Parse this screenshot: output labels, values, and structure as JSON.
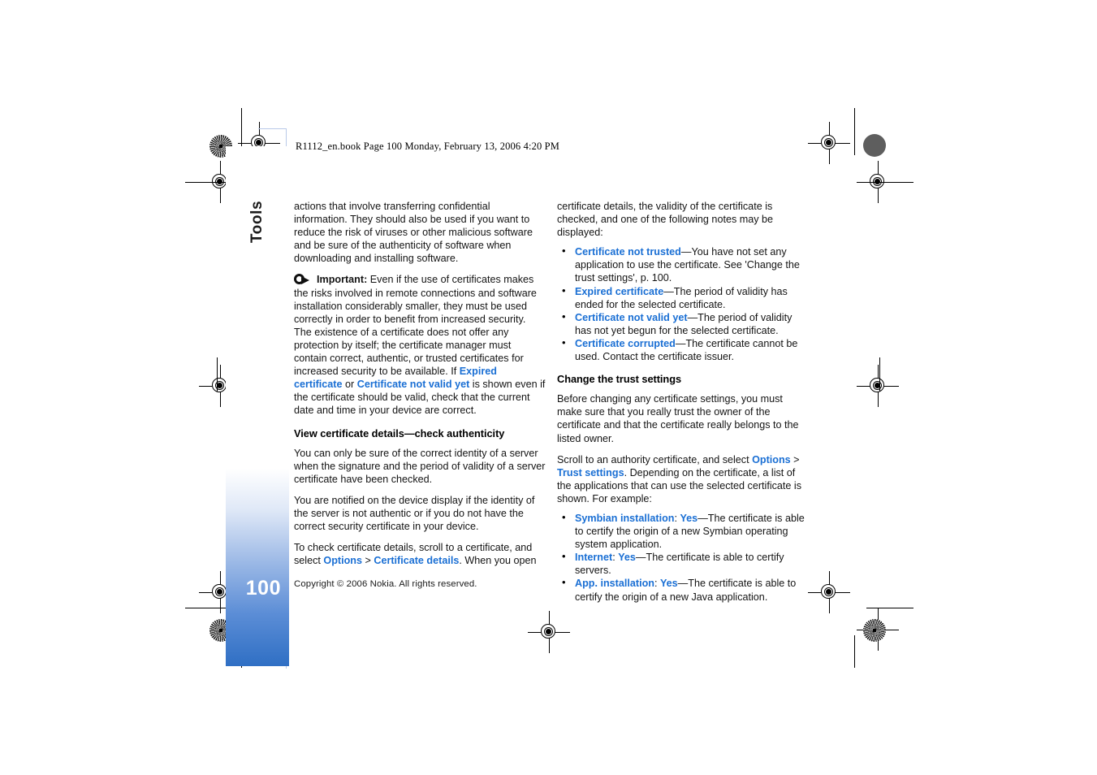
{
  "header": {
    "book_tag": "R1112_en.book  Page 100  Monday, February 13, 2006  4:20 PM"
  },
  "sidebar": {
    "chapter_label": "Tools",
    "page_number": "100",
    "accent_color": "#2f6fc4"
  },
  "theme": {
    "link_color": "#1a6fd4",
    "text_color": "#141414"
  },
  "left_column": {
    "para_1": "actions that involve transferring confidential information. They should also be used if you want to reduce the risk of viruses or other malicious software and be sure of the authenticity of software when downloading and installing software.",
    "important": {
      "label": "Important:",
      "text_before_links": " Even if the use of certificates makes the risks involved in remote connections and software installation considerably smaller, they must be used correctly in order to benefit from increased security. The existence of a certificate does not offer any protection by itself; the certificate manager must contain correct, authentic, or trusted certificates for increased security to be available. If ",
      "link_1": "Expired certificate",
      "conjunction": " or ",
      "link_2": "Certificate not valid yet",
      "text_after_links": " is shown even if the certificate should be valid, check that the current date and time in your device are correct."
    },
    "heading_view_details": "View certificate details—check authenticity",
    "para_2": "You can only be sure of the correct identity of a server when the signature and the period of validity of a server certificate have been checked.",
    "para_3": "You are notified on the device display if the identity of the server is not authentic or if you do not have the correct security certificate in your device.",
    "para_4": {
      "text_1": "To check certificate details, scroll to a certificate, and select ",
      "link_options": "Options",
      "separator": " > ",
      "link_cert_details": "Certificate details",
      "text_2": ". When you open"
    }
  },
  "right_column": {
    "para_1": "certificate details, the validity of the certificate is checked, and one of the following notes may be displayed:",
    "notes": [
      {
        "term": "Certificate not trusted",
        "desc": "—You have not set any application to use the certificate. See 'Change the trust settings', p. 100."
      },
      {
        "term": "Expired certificate",
        "desc": "—The period of validity has ended for the selected certificate."
      },
      {
        "term": "Certificate not valid yet",
        "desc": "—The period of validity has not yet begun for the selected certificate."
      },
      {
        "term": "Certificate corrupted",
        "desc": "—The certificate cannot be used. Contact the certificate issuer."
      }
    ],
    "heading_trust": "Change the trust settings",
    "para_2": "Before changing any certificate settings, you must make sure that you really trust the owner of the certificate and that the certificate really belongs to the listed owner.",
    "para_3": {
      "text_1": "Scroll to an authority certificate, and select ",
      "link_options": "Options",
      "separator": " > ",
      "link_trust_settings": "Trust settings",
      "text_2": ". Depending on the certificate, a list of the applications that can use the selected certificate is shown. For example:"
    },
    "trust_items": [
      {
        "term": "Symbian installation",
        "colon": ": ",
        "value": "Yes",
        "desc": "—The certificate is able to certify the origin of a new Symbian operating system application."
      },
      {
        "term": "Internet",
        "colon": ": ",
        "value": "Yes",
        "desc": "—The certificate is able to certify servers."
      },
      {
        "term": "App. installation",
        "colon": ": ",
        "value": "Yes",
        "desc": "—The certificate is able to certify the origin of a new Java application."
      }
    ]
  },
  "footer": {
    "copyright": "Copyright © 2006 Nokia. All rights reserved."
  }
}
